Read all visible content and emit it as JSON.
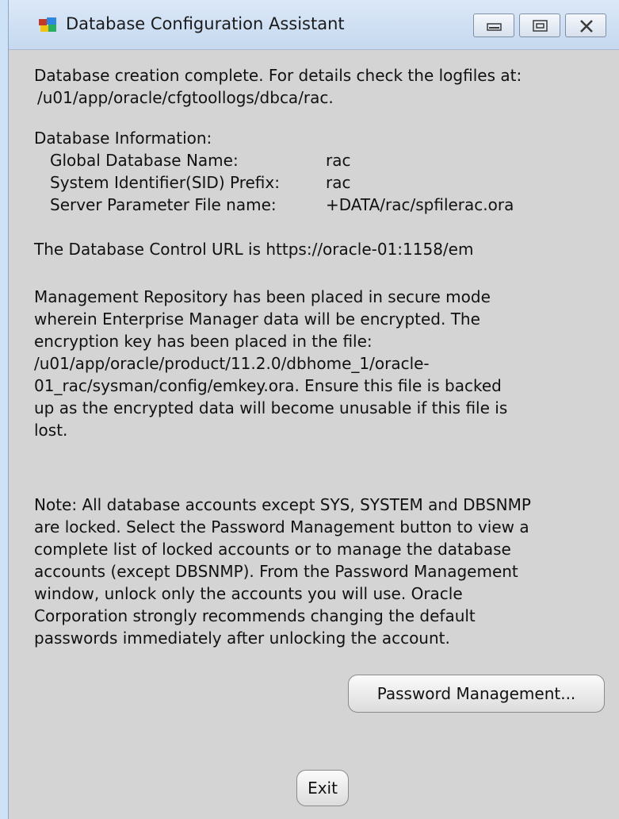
{
  "window": {
    "title": "Database Configuration Assistant",
    "icon": "oracle-dbca-icon",
    "controls": [
      "minimize-icon",
      "maximize-icon",
      "close-icon"
    ]
  },
  "summary": {
    "line1": "Database creation complete. For details check the logfiles at:",
    "line2": "/u01/app/oracle/cfgtoollogs/dbca/rac."
  },
  "db_info": {
    "heading": "Database Information:",
    "rows": [
      {
        "label": "Global Database Name:",
        "value": "rac"
      },
      {
        "label": "System Identifier(SID) Prefix:",
        "value": "rac"
      },
      {
        "label": "Server Parameter File name:",
        "value": "+DATA/rac/spfilerac.ora"
      }
    ]
  },
  "control_url": "The Database Control URL is https://oracle-01:1158/em",
  "repository_note": [
    "Management Repository has been placed in secure mode",
    "wherein Enterprise Manager data will be encrypted.  The",
    "encryption key has been placed in the file:",
    "/u01/app/oracle/product/11.2.0/dbhome_1/oracle-",
    "01_rac/sysman/config/emkey.ora. Ensure this file is backed",
    "up as the encrypted data will become unusable if this file is",
    "lost."
  ],
  "accounts_note": [
    "Note: All database accounts except SYS, SYSTEM and DBSNMP",
    "are locked. Select the Password Management button to view a",
    "complete list of locked accounts or to manage the database",
    "accounts (except DBSNMP). From the Password Management",
    "window, unlock only the accounts you will use. Oracle",
    "Corporation strongly recommends changing the default",
    "passwords immediately after unlocking the account."
  ],
  "buttons": {
    "password_management": "Password Management...",
    "exit": "Exit"
  }
}
